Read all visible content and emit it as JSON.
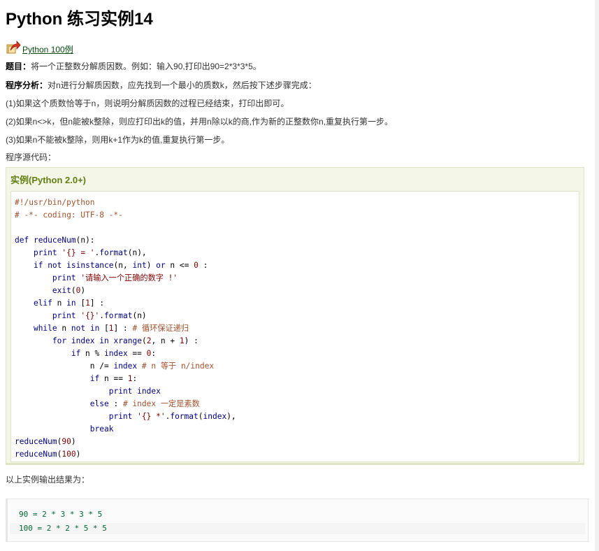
{
  "title": "Python 练习实例14",
  "back_link": "Python 100例",
  "problem_label": "题目：",
  "problem_text": "将一个正整数分解质因数。例如：输入90,打印出90=2*3*3*5。",
  "analysis_label": "程序分析：",
  "analysis_text": "对n进行分解质因数，应先找到一个最小的质数k，然后按下述步骤完成：",
  "steps": [
    "(1)如果这个质数恰等于n，则说明分解质因数的过程已经结束，打印出即可。",
    "(2)如果n<>k，但n能被k整除，则应打印出k的值，并用n除以k的商,作为新的正整数你n,重复执行第一步。",
    "(3)如果n不能被k整除，则用k+1作为k的值,重复执行第一步。"
  ],
  "source_label": "程序源代码：",
  "example_title": "实例(Python 2.0+)",
  "output_label": "以上实例输出结果为：",
  "output_lines": [
    "90 =  2 * 3 * 3 * 5",
    "100 =  2 * 2 * 5 * 5"
  ],
  "icons": {
    "back": "back-arrow-icon"
  }
}
